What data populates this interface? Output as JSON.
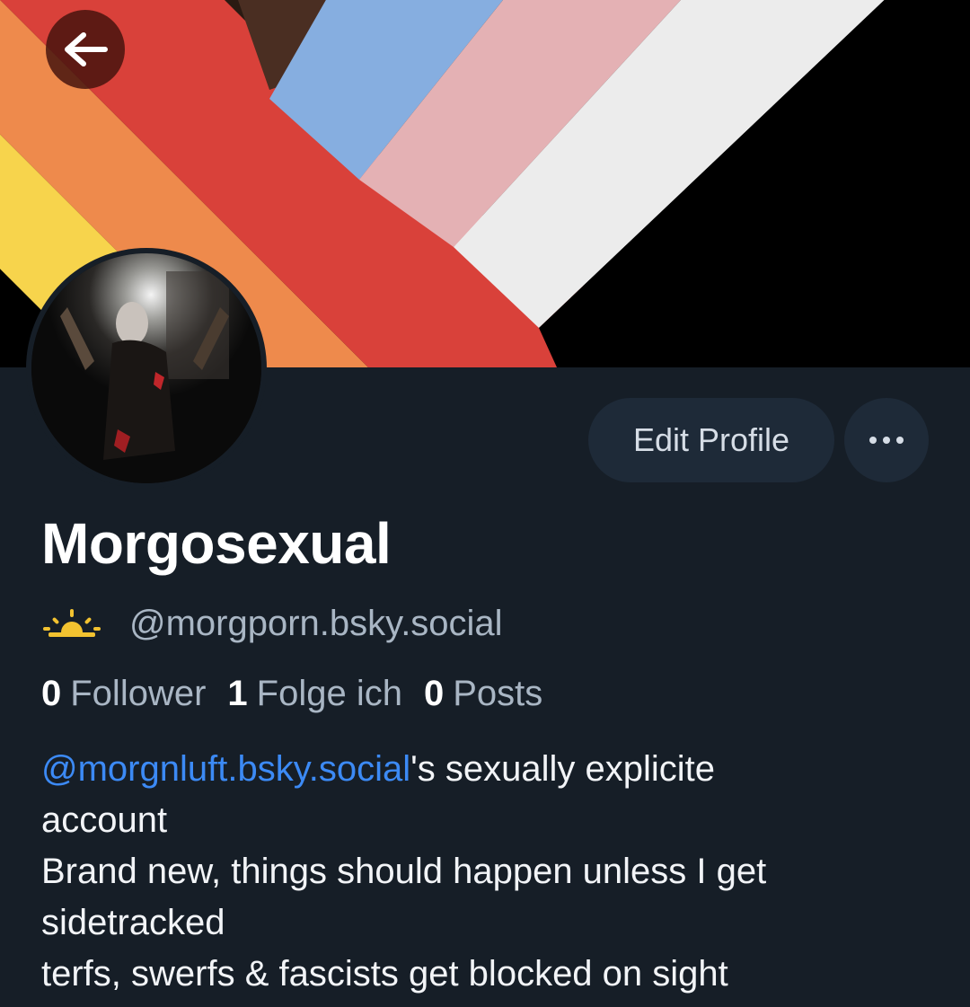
{
  "colors": {
    "background": "#161e27",
    "button_bg": "#1e2a38",
    "link": "#3c8af5",
    "muted_text": "#a9b6c4",
    "banner_stripes": [
      "#f7d44c",
      "#ee8a4c",
      "#d9413a",
      "#4a2e22",
      "#86aee0",
      "#e4b1b4",
      "#ececec",
      "#000000"
    ]
  },
  "header": {
    "back_icon": "arrow-left-icon"
  },
  "profile": {
    "avatar_icon": "avatar-photo",
    "edit_label": "Edit Profile",
    "more_icon": "ellipsis-icon",
    "display_name": "Morgosexual",
    "handle_icon": "sunrise-icon",
    "handle": "@morgporn.bsky.social"
  },
  "stats": [
    {
      "count": "0",
      "label": "Follower"
    },
    {
      "count": "1",
      "label": "Folge ich"
    },
    {
      "count": "0",
      "label": "Posts"
    }
  ],
  "bio": {
    "mention": "@morgnluft.bsky.social",
    "line1_rest": "'s sexually explicite",
    "line2": "account",
    "line3": "Brand new, things should happen unless I get",
    "line4": "sidetracked",
    "line5": "terfs, swerfs & fascists get blocked on sight"
  }
}
